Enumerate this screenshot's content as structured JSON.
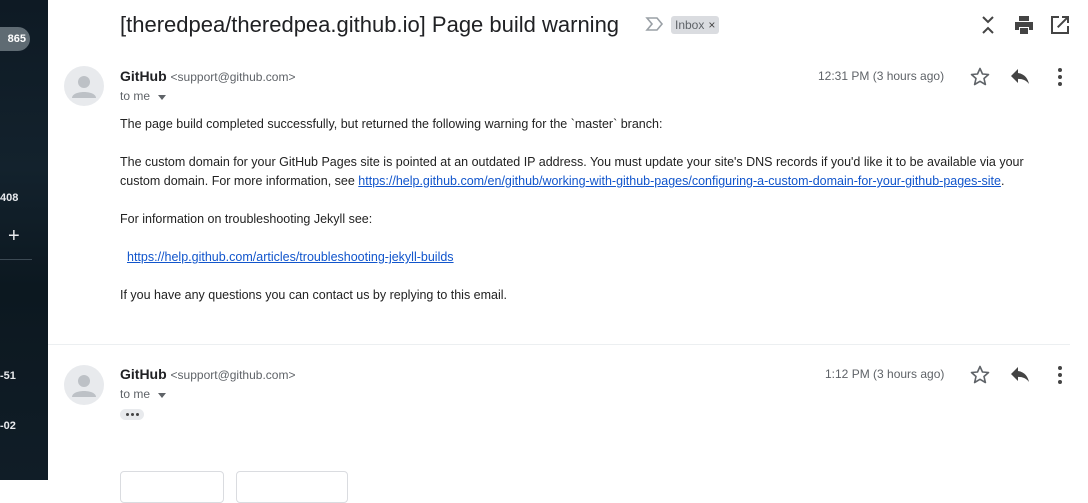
{
  "sidebar": {
    "count_badge": "865",
    "label_408": "408",
    "label_51": "-51",
    "label_02": "-02",
    "plus": "+"
  },
  "thread": {
    "subject": "[theredpea/theredpea.github.io] Page build warning",
    "label": "Inbox",
    "label_close": "×"
  },
  "messages": [
    {
      "sender_name": "GitHub",
      "sender_email": "<support@github.com>",
      "to_me": "to me",
      "time": "12:31 PM (3 hours ago)",
      "body": {
        "line1": "The page build completed successfully, but returned the following warning for the `master` branch:",
        "line2": "The custom domain for your GitHub Pages site is pointed at an outdated IP address. You must update your site's DNS records if you'd like it to be available via your custom domain. For more information, see ",
        "link1": "https://help.github.com/en/github/working-with-github-pages/configuring-a-custom-domain-for-your-github-pages-site",
        "line2_end": ".",
        "line3": "For information on troubleshooting Jekyll see:",
        "link2": "https://help.github.com/articles/troubleshooting-jekyll-builds",
        "line4": "If you have any questions you can contact us by replying to this email."
      }
    },
    {
      "sender_name": "GitHub",
      "sender_email": "<support@github.com>",
      "to_me": "to me",
      "time": "1:12 PM (3 hours ago)"
    }
  ],
  "icons": {
    "collapse": "collapse-all-icon",
    "print": "print-icon",
    "open_new": "open-in-new-window-icon",
    "star": "star-icon",
    "reply": "reply-icon",
    "more": "more-vert-icon",
    "importance": "importance-marker-icon"
  },
  "colors": {
    "link": "#1155cc",
    "icon": "#5f6368"
  }
}
